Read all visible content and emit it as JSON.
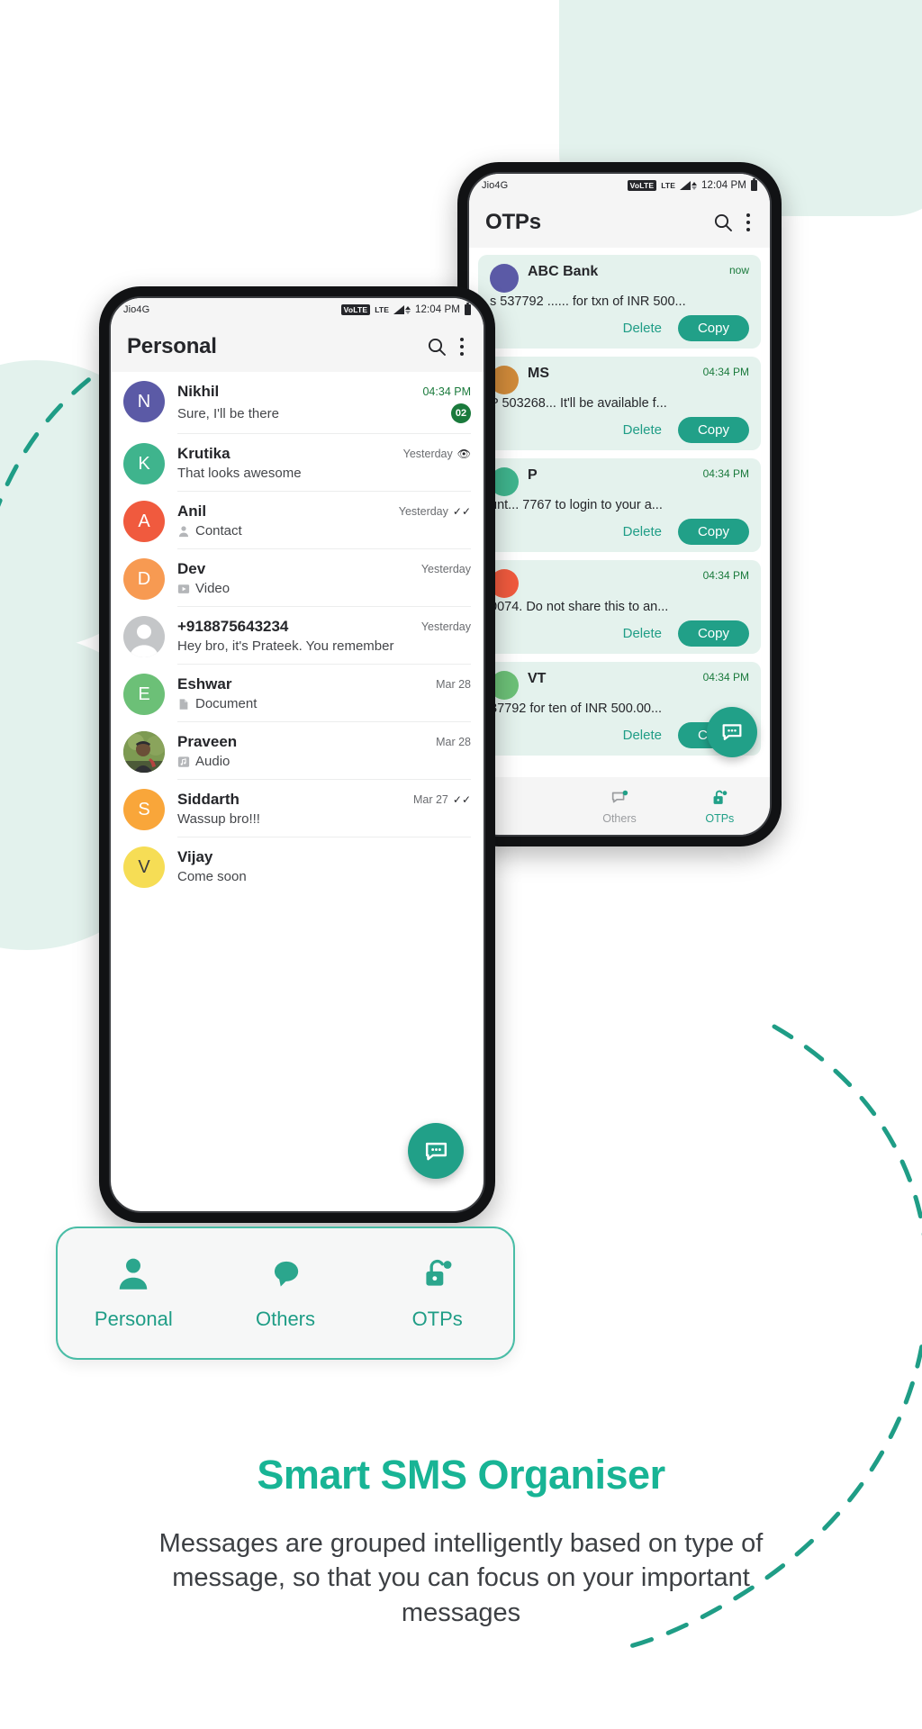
{
  "statusbar": {
    "carrier": "Jio4G",
    "volte": "VoLTE",
    "network": "LTE",
    "time": "12:04 PM"
  },
  "personal_phone": {
    "appbar": {
      "title": "Personal",
      "search_icon": "search-icon",
      "more_icon": "overflow-menu-icon"
    },
    "chats": [
      {
        "name": "Nikhil",
        "avatar_letter": "N",
        "avatar_color": "#5b5aa6",
        "preview": "Sure, I'll be there",
        "time": "04:34 PM",
        "unread": "02",
        "attachment": ""
      },
      {
        "name": "Krutika",
        "avatar_letter": "K",
        "avatar_color": "#3fb48d",
        "preview": "That looks awesome",
        "time": "Yesterday",
        "status": "seen",
        "attachment": ""
      },
      {
        "name": "Anil",
        "avatar_letter": "A",
        "avatar_color": "#f05a3e",
        "preview": "Contact",
        "time": "Yesterday",
        "status": "delivered",
        "attachment": "contact"
      },
      {
        "name": "Dev",
        "avatar_letter": "D",
        "avatar_color": "#f79a52",
        "preview": "Video",
        "time": "Yesterday",
        "attachment": "video"
      },
      {
        "name": "+918875643234",
        "avatar_letter": "",
        "avatar_color": "#c4c6c8",
        "preview": "Hey bro, it's Prateek. You remember",
        "time": "Yesterday",
        "attachment": ""
      },
      {
        "name": "Eshwar",
        "avatar_letter": "E",
        "avatar_color": "#6cc077",
        "preview": "Document",
        "time": "Mar 28",
        "attachment": "document"
      },
      {
        "name": "Praveen",
        "avatar_letter": "",
        "avatar_color": "#6b7d4a",
        "preview": "Audio",
        "time": "Mar 28",
        "attachment": "audio",
        "photo": true
      },
      {
        "name": "Siddarth",
        "avatar_letter": "S",
        "avatar_color": "#f9a63a",
        "preview": "Wassup bro!!!",
        "time": "Mar 27",
        "status": "delivered",
        "attachment": ""
      },
      {
        "name": "Vijay",
        "avatar_letter": "V",
        "avatar_color": "#f6dd55",
        "preview": "Come soon",
        "time": "",
        "attachment": ""
      }
    ],
    "fab_icon": "chat-bubble-icon"
  },
  "otps_phone": {
    "appbar": {
      "title": "OTPs",
      "search_icon": "search-icon",
      "more_icon": "overflow-menu-icon"
    },
    "cards": [
      {
        "sender": "ABC Bank",
        "time": "now",
        "message": "s 537792 ...... for txn of INR 500...",
        "code": "537792",
        "delete_label": "Delete",
        "copy_label": "Copy"
      },
      {
        "sender": "MS",
        "time": "04:34 PM",
        "message": "P 503268... It'll be available f...",
        "code": "503268",
        "delete_label": "Delete",
        "copy_label": "Copy"
      },
      {
        "sender": "P",
        "time": "04:34 PM",
        "message": "unt... 7767 to login to your a...",
        "code": "7767",
        "delete_label": "Delete",
        "copy_label": "Copy"
      },
      {
        "sender": "",
        "time": "04:34 PM",
        "message": "0074. Do not share this to an...",
        "code": "0074",
        "delete_label": "Delete",
        "copy_label": "Copy"
      },
      {
        "sender": "VT",
        "time": "04:34 PM",
        "message": "37792 for ten of INR 500.00...",
        "code": "37792",
        "delete_label": "Delete",
        "copy_label": "Copy"
      }
    ],
    "nav": [
      {
        "label": "Others",
        "icon": "chat-bubble-outline-icon",
        "active": false
      },
      {
        "label": "OTPs",
        "icon": "unlock-icon",
        "active": true
      }
    ],
    "fab_icon": "chat-bubble-icon"
  },
  "bottom_nav": {
    "items": [
      {
        "label": "Personal",
        "icon": "person-icon",
        "active": true
      },
      {
        "label": "Others",
        "icon": "chat-bubble-icon",
        "active": true
      },
      {
        "label": "OTPs",
        "icon": "unlock-icon",
        "active": true
      }
    ]
  },
  "marketing": {
    "headline": "Smart SMS Organiser",
    "subcopy": "Messages are grouped intelligently based on type of message, so that you can focus on your important messages"
  },
  "colors": {
    "accent": "#18b495",
    "teal": "#21a088",
    "card_bg": "#e4f2ed",
    "unread_green": "#1a7a3c",
    "blob": "#e3f2ed"
  }
}
